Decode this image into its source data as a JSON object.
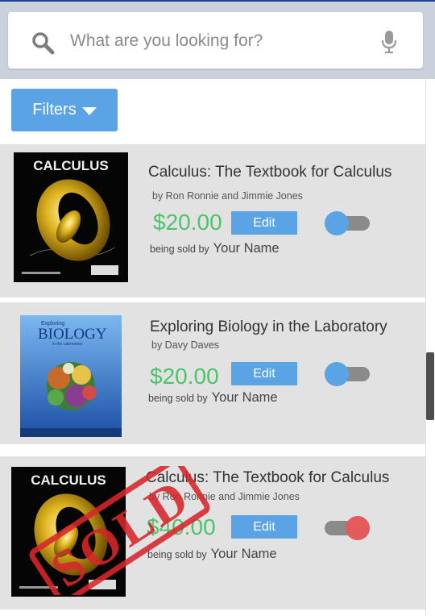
{
  "search": {
    "placeholder": "What are you looking for?"
  },
  "filters": {
    "label": "Filters"
  },
  "listings": [
    {
      "title": "Calculus: The Textbook for Calculus",
      "author": "by Ron Ronnie and Jimmie Jones",
      "price": "$20.00",
      "edit_label": "Edit",
      "sold_by_label": "being sold by",
      "seller": "Your Name",
      "cover_title": "CALCULUS",
      "sold": false
    },
    {
      "title": "Exploring Biology in the Laboratory",
      "author": "by Davy Daves",
      "price": "$20.00",
      "edit_label": "Edit",
      "sold_by_label": "being sold by",
      "seller": "Your Name",
      "cover_small": "Exploring",
      "cover_title": "BIOLOGY",
      "cover_sub": "in the Laboratory",
      "sold": false
    },
    {
      "title": "Calculus: The Textbook for Calculus",
      "author": "by Ron Ronnie and Jimmie Jones",
      "price": "$40.00",
      "edit_label": "Edit",
      "sold_by_label": "being sold by",
      "seller": "Your Name",
      "cover_title": "CALCULUS",
      "sold": true,
      "stamp": "SOLD"
    }
  ],
  "colors": {
    "accent": "#5aa4e6",
    "price": "#4cc46a",
    "toggle_off_knob": "#5aa4e6",
    "toggle_on_knob": "#e45b5b",
    "stamp": "#d8262a"
  }
}
